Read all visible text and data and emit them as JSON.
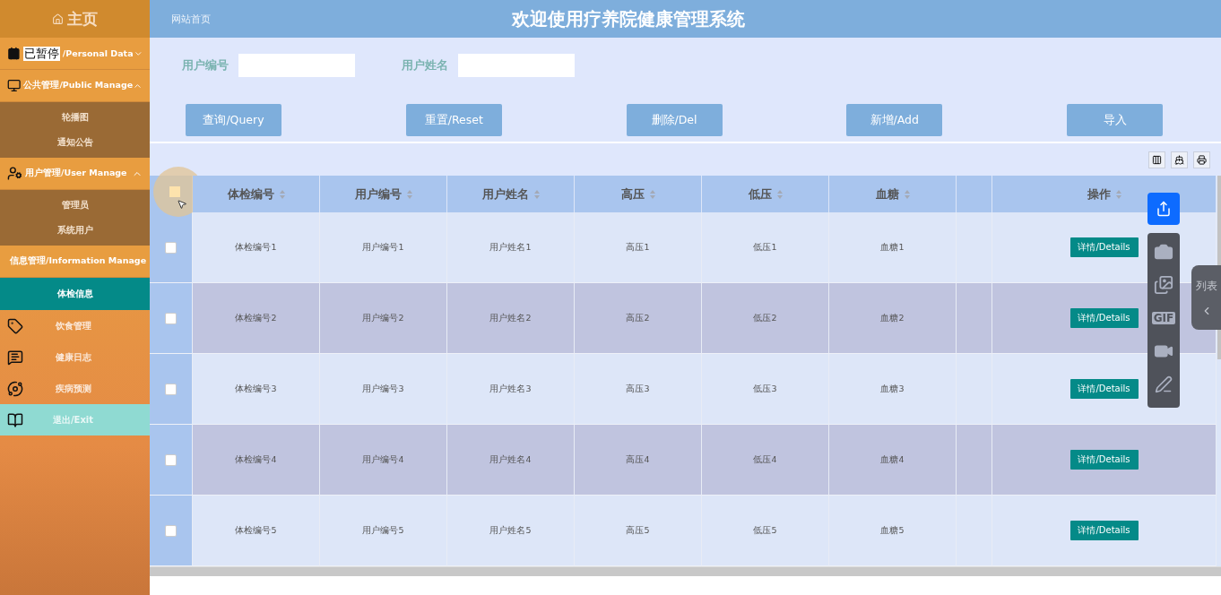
{
  "sidebar": {
    "home": "主页",
    "paused_overlay": "已暂停",
    "menu": [
      {
        "kind": "group",
        "label": "/Personal Data",
        "expanded": false
      },
      {
        "kind": "group",
        "label": "公共管理/Public Manage",
        "expanded": true,
        "children": [
          {
            "label": "轮播图",
            "selected": false
          },
          {
            "label": "通知公告",
            "selected": false
          }
        ]
      },
      {
        "kind": "group",
        "label": "用户管理/User Manage",
        "expanded": true,
        "children": [
          {
            "label": "管理员",
            "selected": false
          },
          {
            "label": "系统用户",
            "selected": false
          }
        ]
      },
      {
        "kind": "group",
        "label": "信息管理/Information Manage",
        "expanded": true,
        "children": [
          {
            "label": "体检信息",
            "selected": true
          }
        ]
      },
      {
        "kind": "item",
        "label": "饮食管理"
      },
      {
        "kind": "item",
        "label": "健康日志"
      },
      {
        "kind": "item",
        "label": "疾病预测"
      },
      {
        "kind": "exit",
        "label": "退出/Exit"
      }
    ]
  },
  "header": {
    "breadcrumb": "网站首页",
    "title": "欢迎使用疗养院健康管理系统"
  },
  "search": [
    {
      "label": "用户编号"
    },
    {
      "label": "用户姓名"
    }
  ],
  "buttons": [
    "查询/Query",
    "重置/Reset",
    "删除/Del",
    "新增/Add",
    "导入"
  ],
  "table": {
    "header_checked": false,
    "columns": [
      "体检编号",
      "用户编号",
      "用户姓名",
      "高压",
      "低压",
      "血糖",
      "操作"
    ],
    "rows": [
      {
        "checked": false,
        "cells": [
          "体检编号1",
          "用户编号1",
          "用户姓名1",
          "高压1",
          "低压1",
          "血糖1"
        ],
        "action": "详情/Details"
      },
      {
        "checked": false,
        "cells": [
          "体检编号2",
          "用户编号2",
          "用户姓名2",
          "高压2",
          "低压2",
          "血糖2"
        ],
        "action": "详情/Details"
      },
      {
        "checked": false,
        "cells": [
          "体检编号3",
          "用户编号3",
          "用户姓名3",
          "高压3",
          "低压3",
          "血糖3"
        ],
        "action": "详情/Details"
      },
      {
        "checked": false,
        "cells": [
          "体检编号4",
          "用户编号4",
          "用户姓名4",
          "高压4",
          "低压4",
          "血糖4"
        ],
        "action": "详情/Details"
      },
      {
        "checked": false,
        "cells": [
          "体检编号5",
          "用户编号5",
          "用户姓名5",
          "高压5",
          "低压5",
          "血糖5"
        ],
        "action": "详情/Details"
      }
    ]
  },
  "recorder": {
    "gif_label": "GIF",
    "side_tab": "列表"
  }
}
